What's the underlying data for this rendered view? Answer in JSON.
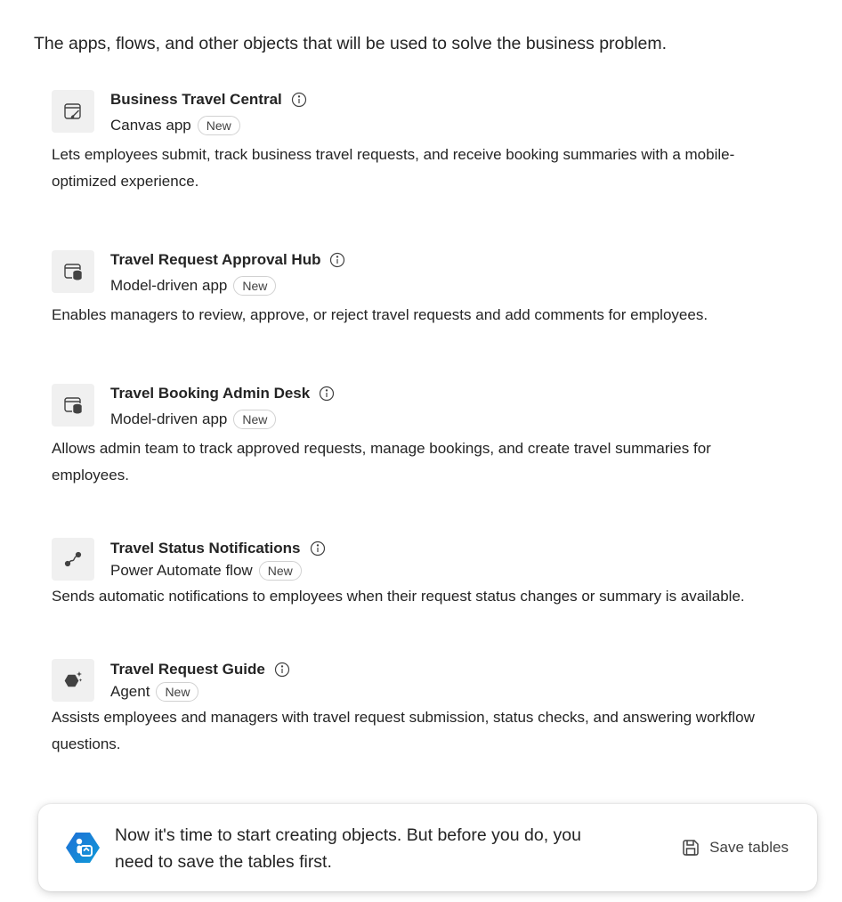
{
  "intro": "The apps, flows, and other objects that will be used to solve the business problem.",
  "badge_label": "New",
  "objects": [
    {
      "title": "Business Travel Central",
      "type": "Canvas app",
      "icon": "canvas-app-icon",
      "description_line1": "Lets employees submit, track business travel requests, and receive booking summaries with a mobile-",
      "description_line2": "optimized experience."
    },
    {
      "title": "Travel Request Approval Hub",
      "type": "Model-driven app",
      "icon": "model-driven-app-icon",
      "description_line1": "Enables managers to review, approve, or reject travel requests and add comments for employees.",
      "description_line2": ""
    },
    {
      "title": "Travel Booking Admin Desk",
      "type": "Model-driven app",
      "icon": "model-driven-app-icon",
      "description_line1": "Allows admin team to track approved requests, manage bookings, and create travel summaries for",
      "description_line2": "employees."
    },
    {
      "title": "Travel Status Notifications",
      "type": "Power Automate flow",
      "icon": "flow-icon",
      "description_line1": "Sends automatic notifications to employees when their request status changes or summary is available.",
      "description_line2": ""
    },
    {
      "title": "Travel Request Guide",
      "type": "Agent",
      "icon": "agent-icon",
      "description_line1": "Assists employees and managers with travel request submission, status checks, and answering workflow",
      "description_line2": "questions."
    }
  ],
  "toast": {
    "line1": "Now it's time to start creating objects. But before you do, you",
    "line2": "need to save the tables first.",
    "button_label": "Save tables",
    "icon": "copilot-icon"
  }
}
